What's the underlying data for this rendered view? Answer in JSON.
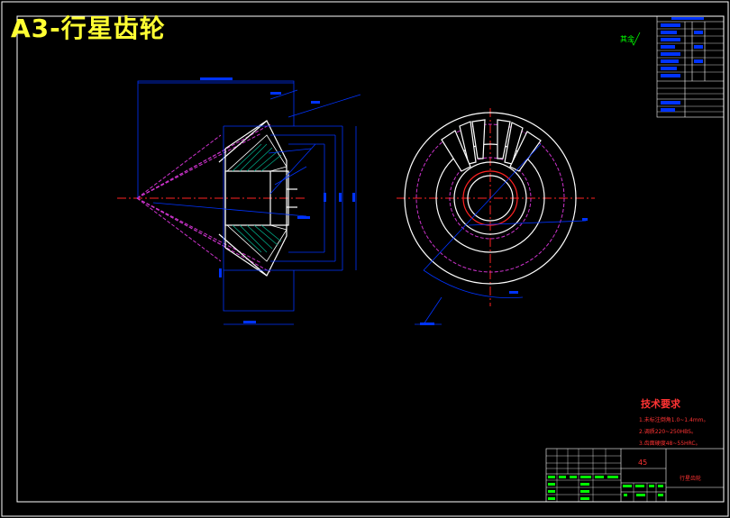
{
  "drawing": {
    "title": "A3-行星齿轮",
    "roughness_note": "其余",
    "material": "45",
    "part_name": "行星齿轮",
    "technical_requirements": {
      "heading": "技术要求",
      "items": [
        "1.未标注倒角1.0~1.4mm。",
        "2.调质220~250HBS。",
        "3.齿面硬度48~55HRC。"
      ]
    }
  },
  "colors": {
    "background": "#000000",
    "border": "#ffffff",
    "outline": "#ffffff",
    "dimension": "#0033ff",
    "centerline": "#ff2222",
    "hidden": "#cc33cc",
    "hatch": "#00aa88",
    "table": "#00ff00",
    "title": "#ffff33",
    "notes": "#ff3333"
  }
}
